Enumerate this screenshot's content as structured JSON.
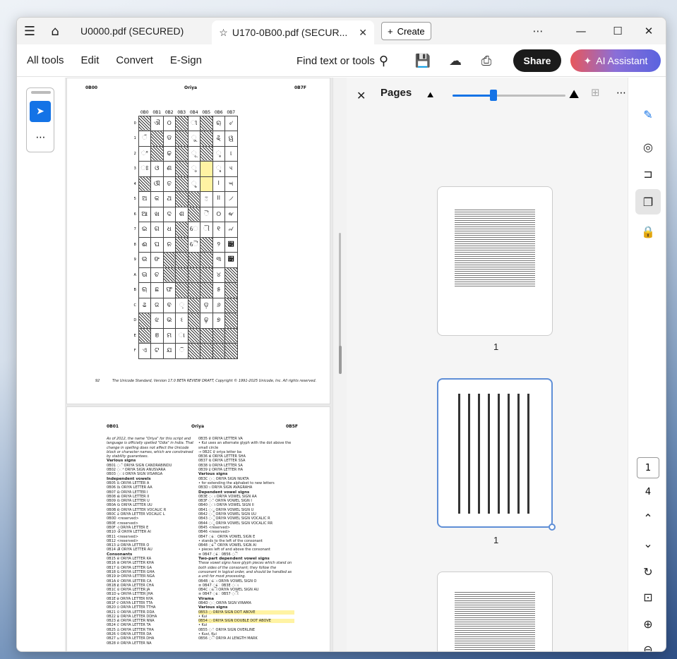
{
  "tabs": [
    {
      "label": "U0000.pdf (SECURED)"
    },
    {
      "label": "U170-0B00.pdf (SECUR...",
      "active": true
    }
  ],
  "create_label": "Create",
  "toolbar": {
    "all_tools": "All tools",
    "edit": "Edit",
    "convert": "Convert",
    "esign": "E-Sign",
    "find": "Find text or tools",
    "share": "Share",
    "ai": "AI Assistant"
  },
  "page1": {
    "left_code": "0B00",
    "title": "Oriya",
    "right_code": "0B7F",
    "columns": [
      "0B0",
      "0B1",
      "0B2",
      "0B3",
      "0B4",
      "0B5",
      "0B6",
      "0B7"
    ],
    "rows": [
      "0",
      "1",
      "2",
      "3",
      "4",
      "5",
      "6",
      "7",
      "8",
      "9",
      "A",
      "B",
      "C",
      "D",
      "E",
      "F"
    ],
    "footer_page": "92",
    "footer_text": "The Unicode Standard, Version 17.0 BETA REVIEW DRAFT, Copyright © 1991-2025 Unicode, Inc. All rights reserved."
  },
  "page2": {
    "left_code": "0B01",
    "title": "Oriya",
    "right_code": "0B5F",
    "intro": "As of 2012, the name \"Oriya\" for this script and language is officially spelled \"Odia\" in India. That change in spelling does not affect the Unicode block or character names, which are constrained by stability guarantees.",
    "various_signs": "Various signs",
    "vs_items": [
      "0B01  ◌ଁ  ORIYA SIGN CANDRABINDU",
      "0B02  ◌ଂ  ORIYA SIGN ANUSVARA",
      "0B03  ◌ଃ  ORIYA SIGN VISARGA"
    ],
    "indep_vowels": "Independent vowels",
    "iv_items": [
      "0B05  ଅ  ORIYA LETTER A",
      "0B06  ଆ  ORIYA LETTER AA",
      "0B07  ଇ  ORIYA LETTER I",
      "0B08  ଈ  ORIYA LETTER II",
      "0B09  ଉ  ORIYA LETTER U",
      "0B0A  ଊ  ORIYA LETTER UU",
      "0B0B  ଋ  ORIYA LETTER VOCALIC R",
      "0B0C  ଌ  ORIYA LETTER VOCALIC L",
      "0B0D     <reserved>",
      "0B0E     <reserved>",
      "0B0F  ଏ  ORIYA LETTER E",
      "0B10  ଐ  ORIYA LETTER AI",
      "0B11     <reserved>",
      "0B12     <reserved>",
      "0B13  ଓ  ORIYA LETTER O",
      "0B14  ଔ  ORIYA LETTER AU"
    ],
    "consonants": "Consonants",
    "c_items": [
      "0B15  କ  ORIYA LETTER KA",
      "0B16  ଖ  ORIYA LETTER KHA",
      "0B17  ଗ  ORIYA LETTER GA",
      "0B18  ଘ  ORIYA LETTER GHA",
      "0B19  ଙ  ORIYA LETTER NGA",
      "0B1A  ଚ  ORIYA LETTER CA",
      "0B1B  ଛ  ORIYA LETTER CHA",
      "0B1C  ଜ  ORIYA LETTER JA",
      "0B1D  ଝ  ORIYA LETTER JHA",
      "0B1E  ଞ  ORIYA LETTER NYA",
      "0B1F  ଟ  ORIYA LETTER TTA",
      "0B20  ଠ  ORIYA LETTER TTHA",
      "0B21  ଡ  ORIYA LETTER DDA",
      "0B22  ଢ  ORIYA LETTER DDHA",
      "0B23  ଣ  ORIYA LETTER NNA",
      "0B24  ତ  ORIYA LETTER TA",
      "0B25  ଥ  ORIYA LETTER THA",
      "0B26  ଦ  ORIYA LETTER DA",
      "0B27  ଧ  ORIYA LETTER DHA",
      "0B28  ନ  ORIYA LETTER NA"
    ],
    "r_items": [
      "0B35  ଵ  ORIYA LETTER VA",
      "• Kui uses an alternate glyph with the dot above the small circle",
      "→ 0B2C ବ oriya letter ba",
      "0B36  ଶ  ORIYA LETTER SHA",
      "0B37  ଷ  ORIYA LETTER SSA",
      "0B38  ସ  ORIYA LETTER SA",
      "0B39  ହ  ORIYA LETTER HA"
    ],
    "r_various": "Various signs",
    "r_vs_items": [
      "0B3C  ◌଼  ORIYA SIGN NUKTA",
      "• for extending the alphabet to new letters",
      "0B3D  ଽ  ORIYA SIGN AVAGRAHA"
    ],
    "dep_vowels": "Dependent vowel signs",
    "dv_items": [
      "0B3E  ◌ା  ORIYA VOWEL SIGN AA",
      "0B3F  ◌ି  ORIYA VOWEL SIGN I",
      "0B40  ◌ୀ  ORIYA VOWEL SIGN II",
      "0B41  ◌ୁ  ORIYA VOWEL SIGN U",
      "0B42  ◌ୂ  ORIYA VOWEL SIGN UU",
      "0B43  ◌ୃ  ORIYA VOWEL SIGN VOCALIC R",
      "0B44  ◌ୄ  ORIYA VOWEL SIGN VOCALIC RR",
      "0B45     <reserved>",
      "0B46     <reserved>",
      "0B47  ◌େ  ORIYA VOWEL SIGN E",
      "• stands to the left of the consonant",
      "0B48  ◌ୈ  ORIYA VOWEL SIGN AI",
      "• pieces left of and above the consonant",
      "≡ 0B47 ◌େ 0B56 ◌ୖ"
    ],
    "two_part": "Two-part dependent vowel signs",
    "two_part_note": "These vowel signs have glyph pieces which stand on both sides of the consonant; they follow the consonant in logical order, and should be handled as a unit for most processing.",
    "tp_items": [
      "0B4B  ◌ୋ  ORIYA VOWEL SIGN O",
      "≡ 0B47 ◌େ 0B3E ◌ା",
      "0B4C  ◌ୌ  ORIYA VOWEL SIGN AU",
      "≡ 0B47 ◌େ 0B57 ◌ୗ"
    ],
    "virama": "Virama",
    "virama_item": "0B4D  ◌୍  ORIYA SIGN VIRAMA",
    "vs2": "Various signs",
    "vs2_items": [
      "0B53  ◌  ORIYA SIGN DOT ABOVE",
      "• Kui",
      "0B54  ◌  ORIYA SIGN DOUBLE DOT ABOVE",
      "• Kui",
      "0B55  ◌୕  ORIYA SIGN OVERLINE",
      "• Kuvi, Kui",
      "0B56  ◌ୖ  ORIYA AI LENGTH MARK"
    ]
  },
  "pages_panel": {
    "title": "Pages",
    "thumb1_label": "1",
    "thumb2_label": "1"
  },
  "right_rail": {
    "page_input": "1",
    "total_pages": "4"
  }
}
